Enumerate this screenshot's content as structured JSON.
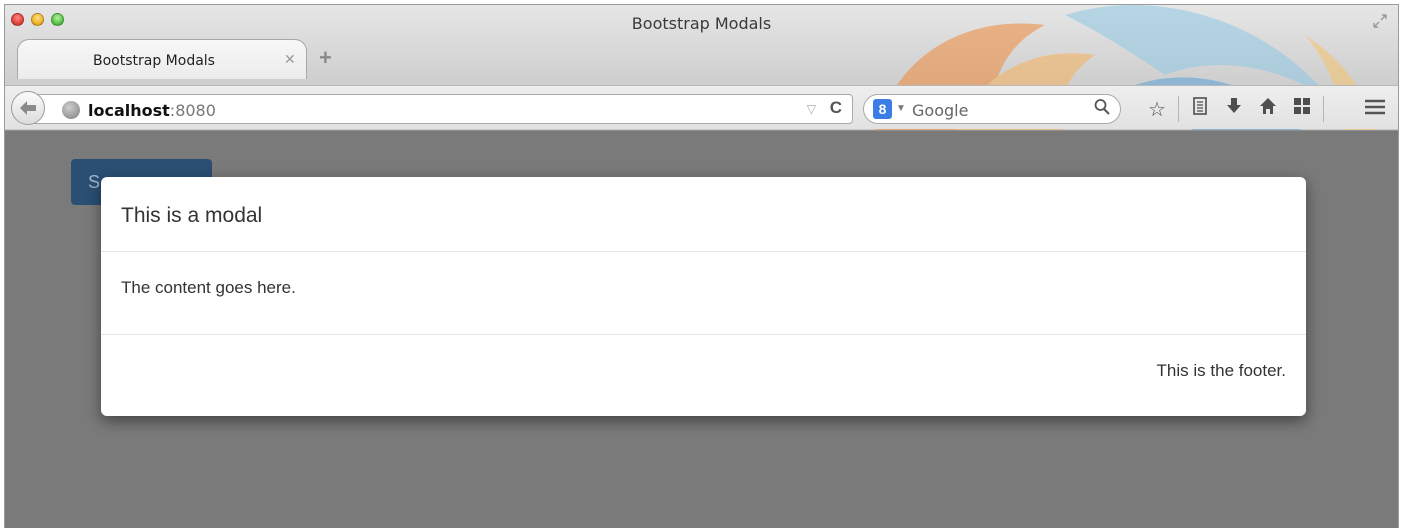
{
  "window": {
    "title": "Bootstrap Modals"
  },
  "tabs": [
    {
      "label": "Bootstrap Modals"
    }
  ],
  "toolbar": {
    "url_host": "localhost",
    "url_port": ":8080",
    "search_engine": "8",
    "search_placeholder": "Google"
  },
  "icons": {
    "back": "back-arrow-icon",
    "site": "globe-icon",
    "reload": "reload-icon",
    "search": "magnifier-icon",
    "bookmark": "star-icon",
    "reading_list": "bookmarks-list-icon",
    "downloads": "download-icon",
    "home": "home-icon",
    "apps": "grid-icon",
    "menu": "hamburger-menu-icon"
  },
  "page": {
    "button_label": "S"
  },
  "modal": {
    "title": "This is a modal",
    "body": "The content goes here.",
    "footer": "This is the footer."
  },
  "colors": {
    "backdrop": "#7a7a7a",
    "page_button": "#2a4f73",
    "modal_bg": "#ffffff",
    "text": "#333333"
  }
}
